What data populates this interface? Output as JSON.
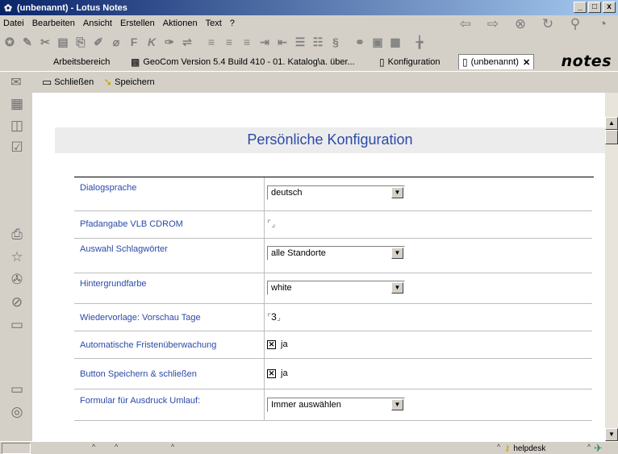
{
  "window": {
    "title": "(unbenannt) - Lotus Notes",
    "buttons": [
      "_",
      "□",
      "x"
    ]
  },
  "menu": [
    "Datei",
    "Bearbeiten",
    "Ansicht",
    "Erstellen",
    "Aktionen",
    "Text",
    "?"
  ],
  "nav_icons": [
    "back-arrow-icon",
    "forward-arrow-icon",
    "stop-icon",
    "refresh-icon",
    "search-icon",
    "web-icon"
  ],
  "toolbar_icons": [
    "smarticon-1",
    "smarticon-2",
    "smarticon-3",
    "smarticon-4",
    "smarticon-5",
    "smarticon-6",
    "bold-f",
    "italic-k",
    "smarticon-9",
    "smarticon-10",
    "align-left",
    "align-center",
    "align-right",
    "indent",
    "outdent",
    "bullets",
    "numbers",
    "smarticon-18",
    "smarticon-19",
    "smarticon-20",
    "smarticon-21",
    "smarticon-22"
  ],
  "toolbar_glyphs": [
    "F",
    "K"
  ],
  "tabs": [
    {
      "label": "Arbeitsbereich",
      "active": false
    },
    {
      "label": "GeoCom Version 5.4  Build 410 - 01. Katalog\\a. über...",
      "active": false
    },
    {
      "label": "Konfiguration",
      "active": false
    },
    {
      "label": "(unbenannt)",
      "active": true
    }
  ],
  "brand": "notes",
  "actions": {
    "close_label": "Schließen",
    "save_label": "Speichern"
  },
  "form": {
    "title": "Persönliche Konfiguration",
    "fields": [
      {
        "label": "Dialogsprache",
        "type": "select",
        "value": "deutsch"
      },
      {
        "label": "Pfadangabe VLB CDROM",
        "type": "text",
        "value": ""
      },
      {
        "label": "Auswahl Schlagwörter",
        "type": "select",
        "value": "alle Standorte"
      },
      {
        "label": "Hintergrundfarbe",
        "type": "select",
        "value": "white"
      },
      {
        "label": "Wiedervorlage: Vorschau Tage",
        "type": "text",
        "value": "3"
      },
      {
        "label": "Automatische Fristenüberwachung",
        "type": "checkbox",
        "value": "ja",
        "checked": true
      },
      {
        "label": "Button Speichern & schließen",
        "type": "checkbox",
        "value": "ja",
        "checked": true
      },
      {
        "label": "Formular für Ausdruck Umlauf:",
        "type": "select",
        "value": "Immer auswählen"
      }
    ]
  },
  "status": {
    "location": "helpdesk"
  }
}
